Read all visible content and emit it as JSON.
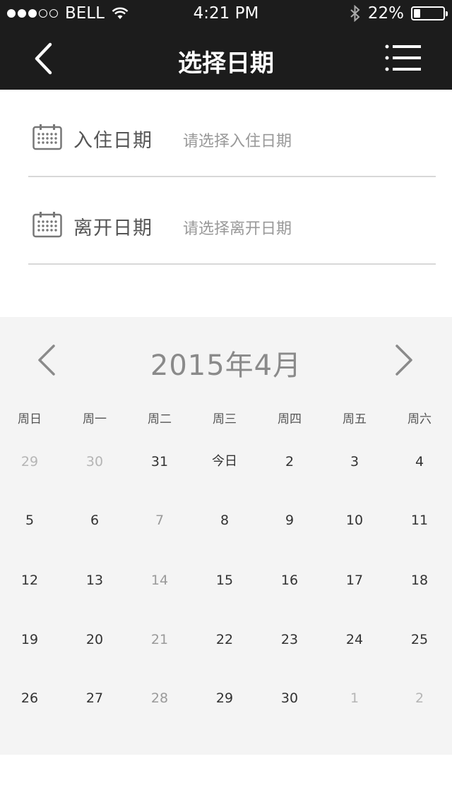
{
  "status": {
    "carrier": "BELL",
    "time": "4:21 PM",
    "battery": "22%",
    "battery_level": 0.22,
    "signal_bars": 3,
    "signal_total": 5
  },
  "header": {
    "title": "选择日期",
    "back_icon": "chevron-left-icon",
    "menu_icon": "menu-icon"
  },
  "checkin": {
    "label": "入住日期",
    "placeholder": "请选择入住日期",
    "icon": "calendar-icon"
  },
  "checkout": {
    "label": "离开日期",
    "placeholder": "请选择离开日期",
    "icon": "calendar-icon"
  },
  "calendar": {
    "month_title": "2015年4月",
    "weekdays": [
      "周日",
      "周一",
      "周二",
      "周三",
      "周四",
      "周五",
      "周六"
    ],
    "weeks": [
      [
        {
          "t": "29",
          "s": "other"
        },
        {
          "t": "30",
          "s": "other"
        },
        {
          "t": "31",
          "s": "cur"
        },
        {
          "t": "今日",
          "s": "today"
        },
        {
          "t": "2",
          "s": "cur"
        },
        {
          "t": "3",
          "s": "cur"
        },
        {
          "t": "4",
          "s": "cur"
        }
      ],
      [
        {
          "t": "5",
          "s": "cur"
        },
        {
          "t": "6",
          "s": "cur"
        },
        {
          "t": "7",
          "s": "past"
        },
        {
          "t": "8",
          "s": "cur"
        },
        {
          "t": "9",
          "s": "cur"
        },
        {
          "t": "10",
          "s": "cur"
        },
        {
          "t": "11",
          "s": "cur"
        }
      ],
      [
        {
          "t": "12",
          "s": "cur"
        },
        {
          "t": "13",
          "s": "cur"
        },
        {
          "t": "14",
          "s": "past"
        },
        {
          "t": "15",
          "s": "cur"
        },
        {
          "t": "16",
          "s": "cur"
        },
        {
          "t": "17",
          "s": "cur"
        },
        {
          "t": "18",
          "s": "cur"
        }
      ],
      [
        {
          "t": "19",
          "s": "cur"
        },
        {
          "t": "20",
          "s": "cur"
        },
        {
          "t": "21",
          "s": "past"
        },
        {
          "t": "22",
          "s": "cur"
        },
        {
          "t": "23",
          "s": "cur"
        },
        {
          "t": "24",
          "s": "cur"
        },
        {
          "t": "25",
          "s": "cur"
        }
      ],
      [
        {
          "t": "26",
          "s": "cur"
        },
        {
          "t": "27",
          "s": "cur"
        },
        {
          "t": "28",
          "s": "past"
        },
        {
          "t": "29",
          "s": "cur"
        },
        {
          "t": "30",
          "s": "cur"
        },
        {
          "t": "1",
          "s": "other"
        },
        {
          "t": "2",
          "s": "other"
        }
      ]
    ]
  },
  "colors": {
    "header_bg": "#1c1c1c",
    "calendar_bg": "#f4f4f4",
    "muted": "#b5b5b5"
  }
}
